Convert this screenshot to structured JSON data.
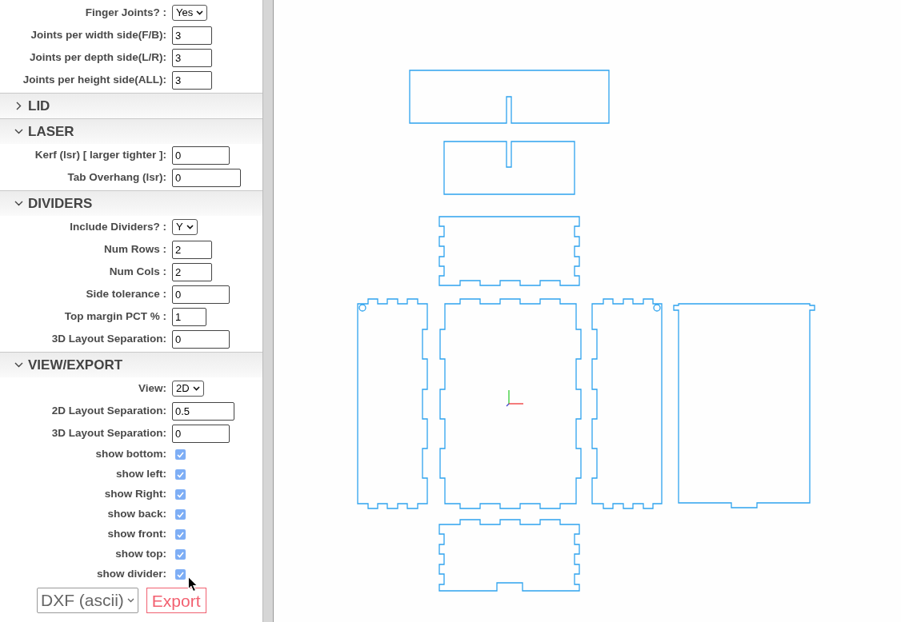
{
  "sections": [
    {
      "fields": [
        {
          "kind": "select",
          "label": "Finger Joints? :",
          "value": "Yes"
        },
        {
          "kind": "input",
          "label": "Joints per width side(F/B):",
          "value": "3"
        },
        {
          "kind": "input",
          "label": "Joints per depth side(L/R):",
          "value": "3"
        },
        {
          "kind": "input",
          "label": "Joints per height side(ALL):",
          "value": "3"
        }
      ]
    },
    {
      "title": "LID",
      "expanded": false
    },
    {
      "title": "LASER",
      "expanded": true,
      "fields": [
        {
          "kind": "input",
          "label": "Kerf (lsr) [ larger tighter ]:",
          "value": "0"
        },
        {
          "kind": "input",
          "label": "Tab Overhang (lsr):",
          "value": "0"
        }
      ]
    },
    {
      "title": "DIVIDERS",
      "expanded": true,
      "fields": [
        {
          "kind": "select",
          "label": "Include Dividers? :",
          "value": "Y"
        },
        {
          "kind": "input",
          "label": "Num Rows :",
          "value": "2"
        },
        {
          "kind": "input",
          "label": "Num Cols :",
          "value": "2"
        },
        {
          "kind": "input",
          "label": "Side tolerance :",
          "value": "0"
        },
        {
          "kind": "input",
          "label": "Top margin PCT % :",
          "value": "1"
        },
        {
          "kind": "input",
          "label": "3D Layout Separation:",
          "value": "0"
        }
      ]
    },
    {
      "title": "VIEW/EXPORT",
      "expanded": true,
      "fields": [
        {
          "kind": "select",
          "label": "View:",
          "value": "2D"
        },
        {
          "kind": "input",
          "label": "2D Layout Separation:",
          "value": "0.5"
        },
        {
          "kind": "input",
          "label": "3D Layout Separation:",
          "value": "0"
        },
        {
          "kind": "checkbox",
          "label": "show bottom:",
          "checked": true
        },
        {
          "kind": "checkbox",
          "label": "show left:",
          "checked": true
        },
        {
          "kind": "checkbox",
          "label": "show Right:",
          "checked": true
        },
        {
          "kind": "checkbox",
          "label": "show back:",
          "checked": true
        },
        {
          "kind": "checkbox",
          "label": "show front:",
          "checked": true
        },
        {
          "kind": "checkbox",
          "label": "show top:",
          "checked": true
        },
        {
          "kind": "checkbox",
          "label": "show divider:",
          "checked": true
        }
      ]
    }
  ],
  "export": {
    "format": "DXF (ascii)",
    "button": "Export"
  }
}
